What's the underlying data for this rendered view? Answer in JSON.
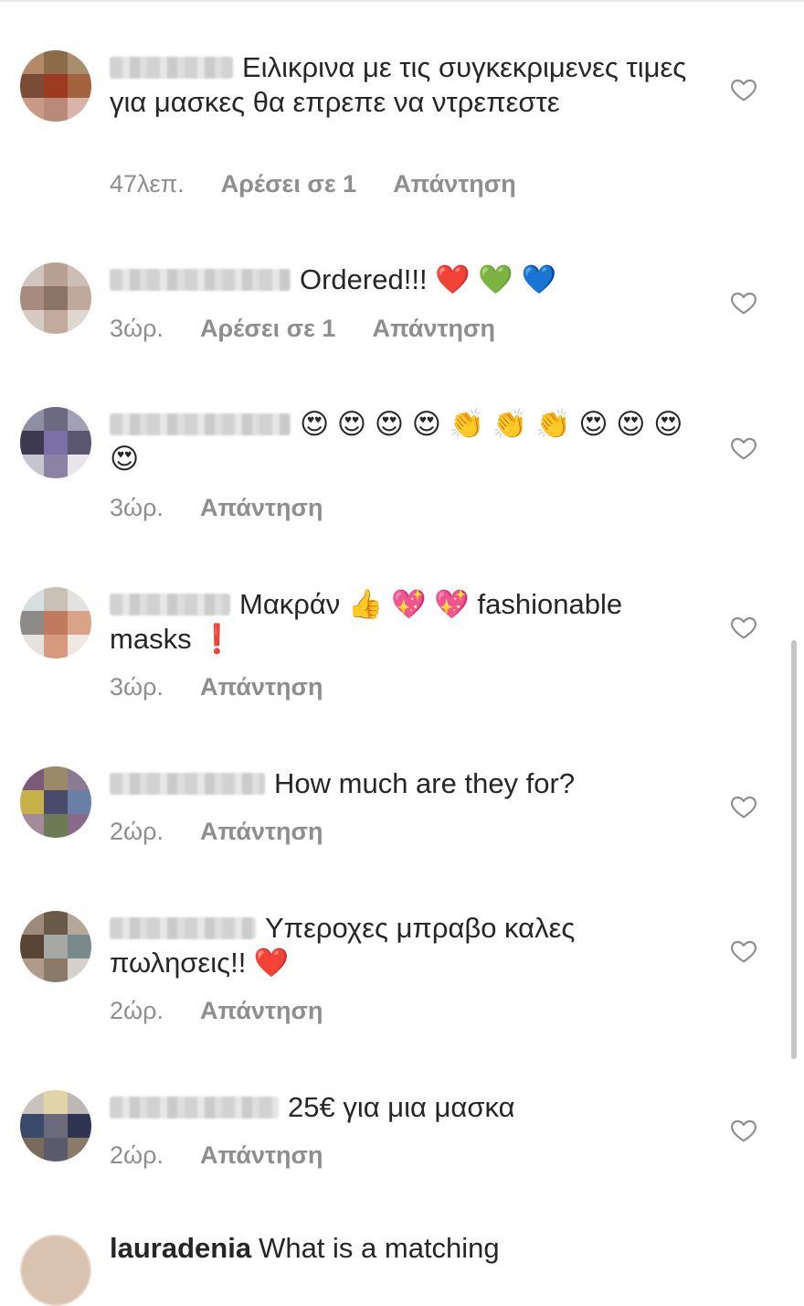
{
  "comments": [
    {
      "text": "Ειλικρινα με τις συγκεκριμενες τιμες για μασκες θα επρεπε να ντρεπεστε",
      "time": "47λεπ.",
      "likes": "Αρέσει σε 1",
      "reply": "Απάντηση",
      "avatar": [
        "#b28a6a",
        "#8c6b4a",
        "#a88d6e",
        "#7a4b35",
        "#9c3b22",
        "#a5623f",
        "#c99a86",
        "#b78a7a",
        "#d9b3a8"
      ]
    },
    {
      "text": "Ordered!!! ❤️ 💚 💙",
      "time": "3ώρ.",
      "likes": "Αρέσει σε 1",
      "reply": "Απάντηση",
      "avatar": [
        "#d0c6c0",
        "#b8a194",
        "#cdbdb5",
        "#a68b7e",
        "#8b7366",
        "#bfa99c",
        "#d6cac4",
        "#c2ab9d",
        "#e0d6d0"
      ]
    },
    {
      "text": "😍 😍 😍 😍 👏 👏 👏 😍 😍 😍 😍",
      "time": "3ώρ.",
      "likes": "",
      "reply": "Απάντηση",
      "avatar": [
        "#8e8fa3",
        "#6b6a80",
        "#a1a1b3",
        "#3d3a4f",
        "#7b6fa6",
        "#5a5570",
        "#c7c5d0",
        "#8a83a3",
        "#e8e6ea"
      ]
    },
    {
      "text": "Μακράν 👍 💖 💖 fashionable masks ❗",
      "time": "3ώρ.",
      "likes": "",
      "reply": "Απάντηση",
      "avatar": [
        "#d8dfe0",
        "#c9c0b8",
        "#e4e2de",
        "#8d8b8a",
        "#c07a5e",
        "#d9a38a",
        "#e6e2dc",
        "#d89a7e",
        "#efe8e2"
      ]
    },
    {
      "text": "How much are they for?",
      "time": "2ώρ.",
      "likes": "",
      "reply": "Απάντηση",
      "avatar": [
        "#7a5a78",
        "#9b8a6a",
        "#8c7a95",
        "#c7b24a",
        "#4a4a6a",
        "#6a7fa5",
        "#a58a9a",
        "#6d7a55",
        "#8a6a8a"
      ]
    },
    {
      "text": "Υπεροχες μπραβο καλες πωλησεις!! ❤️",
      "time": "2ώρ.",
      "likes": "",
      "reply": "Απάντηση",
      "avatar": [
        "#9c8a7a",
        "#6a5a4a",
        "#b5a89a",
        "#5a4535",
        "#a5a8a5",
        "#7a8a8a",
        "#b09a8a",
        "#8a7a6a",
        "#d5d0cc"
      ]
    },
    {
      "text": "25€ για μια μασκα",
      "time": "2ώρ.",
      "likes": "",
      "reply": "Απάντηση",
      "avatar": [
        "#c9c2bd",
        "#e0d4a8",
        "#bdb7b5",
        "#3a4a6a",
        "#6a6a7a",
        "#2f3550",
        "#7a6a5a",
        "#5a5a6a",
        "#8a7a6a"
      ]
    }
  ],
  "partial_comment": {
    "username": "lauradenia",
    "text": "What is a matching"
  },
  "colors": {
    "text": "#262626",
    "meta": "#8e8e8e",
    "heart": "#8e8e8e",
    "scrollbar": "#c4c4c4"
  }
}
